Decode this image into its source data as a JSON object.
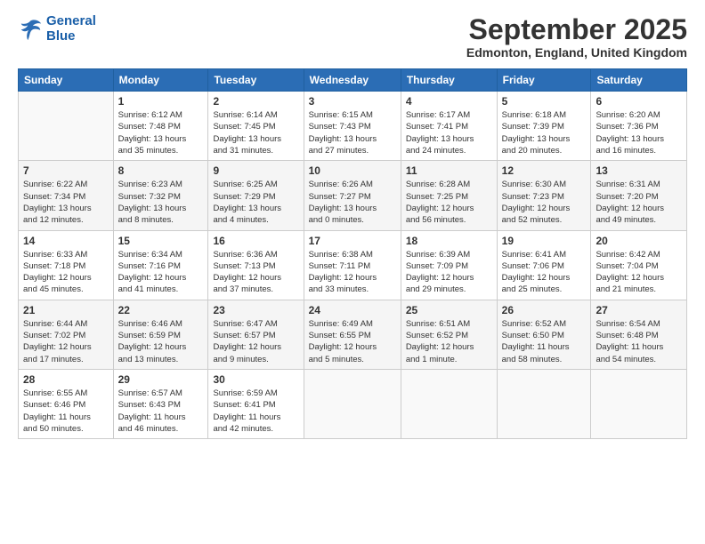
{
  "header": {
    "logo_line1": "General",
    "logo_line2": "Blue",
    "month": "September 2025",
    "location": "Edmonton, England, United Kingdom"
  },
  "weekdays": [
    "Sunday",
    "Monday",
    "Tuesday",
    "Wednesday",
    "Thursday",
    "Friday",
    "Saturday"
  ],
  "weeks": [
    [
      {
        "day": "",
        "info": ""
      },
      {
        "day": "1",
        "info": "Sunrise: 6:12 AM\nSunset: 7:48 PM\nDaylight: 13 hours\nand 35 minutes."
      },
      {
        "day": "2",
        "info": "Sunrise: 6:14 AM\nSunset: 7:45 PM\nDaylight: 13 hours\nand 31 minutes."
      },
      {
        "day": "3",
        "info": "Sunrise: 6:15 AM\nSunset: 7:43 PM\nDaylight: 13 hours\nand 27 minutes."
      },
      {
        "day": "4",
        "info": "Sunrise: 6:17 AM\nSunset: 7:41 PM\nDaylight: 13 hours\nand 24 minutes."
      },
      {
        "day": "5",
        "info": "Sunrise: 6:18 AM\nSunset: 7:39 PM\nDaylight: 13 hours\nand 20 minutes."
      },
      {
        "day": "6",
        "info": "Sunrise: 6:20 AM\nSunset: 7:36 PM\nDaylight: 13 hours\nand 16 minutes."
      }
    ],
    [
      {
        "day": "7",
        "info": "Sunrise: 6:22 AM\nSunset: 7:34 PM\nDaylight: 13 hours\nand 12 minutes."
      },
      {
        "day": "8",
        "info": "Sunrise: 6:23 AM\nSunset: 7:32 PM\nDaylight: 13 hours\nand 8 minutes."
      },
      {
        "day": "9",
        "info": "Sunrise: 6:25 AM\nSunset: 7:29 PM\nDaylight: 13 hours\nand 4 minutes."
      },
      {
        "day": "10",
        "info": "Sunrise: 6:26 AM\nSunset: 7:27 PM\nDaylight: 13 hours\nand 0 minutes."
      },
      {
        "day": "11",
        "info": "Sunrise: 6:28 AM\nSunset: 7:25 PM\nDaylight: 12 hours\nand 56 minutes."
      },
      {
        "day": "12",
        "info": "Sunrise: 6:30 AM\nSunset: 7:23 PM\nDaylight: 12 hours\nand 52 minutes."
      },
      {
        "day": "13",
        "info": "Sunrise: 6:31 AM\nSunset: 7:20 PM\nDaylight: 12 hours\nand 49 minutes."
      }
    ],
    [
      {
        "day": "14",
        "info": "Sunrise: 6:33 AM\nSunset: 7:18 PM\nDaylight: 12 hours\nand 45 minutes."
      },
      {
        "day": "15",
        "info": "Sunrise: 6:34 AM\nSunset: 7:16 PM\nDaylight: 12 hours\nand 41 minutes."
      },
      {
        "day": "16",
        "info": "Sunrise: 6:36 AM\nSunset: 7:13 PM\nDaylight: 12 hours\nand 37 minutes."
      },
      {
        "day": "17",
        "info": "Sunrise: 6:38 AM\nSunset: 7:11 PM\nDaylight: 12 hours\nand 33 minutes."
      },
      {
        "day": "18",
        "info": "Sunrise: 6:39 AM\nSunset: 7:09 PM\nDaylight: 12 hours\nand 29 minutes."
      },
      {
        "day": "19",
        "info": "Sunrise: 6:41 AM\nSunset: 7:06 PM\nDaylight: 12 hours\nand 25 minutes."
      },
      {
        "day": "20",
        "info": "Sunrise: 6:42 AM\nSunset: 7:04 PM\nDaylight: 12 hours\nand 21 minutes."
      }
    ],
    [
      {
        "day": "21",
        "info": "Sunrise: 6:44 AM\nSunset: 7:02 PM\nDaylight: 12 hours\nand 17 minutes."
      },
      {
        "day": "22",
        "info": "Sunrise: 6:46 AM\nSunset: 6:59 PM\nDaylight: 12 hours\nand 13 minutes."
      },
      {
        "day": "23",
        "info": "Sunrise: 6:47 AM\nSunset: 6:57 PM\nDaylight: 12 hours\nand 9 minutes."
      },
      {
        "day": "24",
        "info": "Sunrise: 6:49 AM\nSunset: 6:55 PM\nDaylight: 12 hours\nand 5 minutes."
      },
      {
        "day": "25",
        "info": "Sunrise: 6:51 AM\nSunset: 6:52 PM\nDaylight: 12 hours\nand 1 minute."
      },
      {
        "day": "26",
        "info": "Sunrise: 6:52 AM\nSunset: 6:50 PM\nDaylight: 11 hours\nand 58 minutes."
      },
      {
        "day": "27",
        "info": "Sunrise: 6:54 AM\nSunset: 6:48 PM\nDaylight: 11 hours\nand 54 minutes."
      }
    ],
    [
      {
        "day": "28",
        "info": "Sunrise: 6:55 AM\nSunset: 6:46 PM\nDaylight: 11 hours\nand 50 minutes."
      },
      {
        "day": "29",
        "info": "Sunrise: 6:57 AM\nSunset: 6:43 PM\nDaylight: 11 hours\nand 46 minutes."
      },
      {
        "day": "30",
        "info": "Sunrise: 6:59 AM\nSunset: 6:41 PM\nDaylight: 11 hours\nand 42 minutes."
      },
      {
        "day": "",
        "info": ""
      },
      {
        "day": "",
        "info": ""
      },
      {
        "day": "",
        "info": ""
      },
      {
        "day": "",
        "info": ""
      }
    ]
  ]
}
